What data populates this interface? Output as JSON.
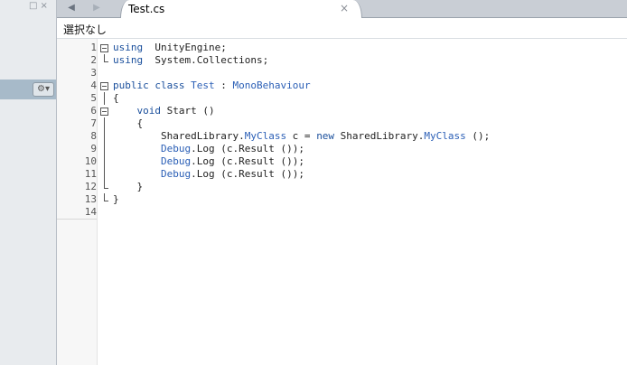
{
  "left_pad": {
    "controls": [
      "□",
      "×"
    ],
    "gear_label": "⚙▾"
  },
  "tabstrip": {
    "back_label": "◀",
    "forward_label": "▶",
    "tab_title": "Test.cs",
    "tab_close": "×"
  },
  "breadcrumb": {
    "text": "選択なし"
  },
  "editor": {
    "lines": [
      {
        "num": "1",
        "tokens": [
          [
            "kw",
            "using"
          ],
          [
            "",
            "  UnityEngine;"
          ]
        ]
      },
      {
        "num": "2",
        "tokens": [
          [
            "kw",
            "using"
          ],
          [
            "",
            "  System.Collections;"
          ]
        ]
      },
      {
        "num": "3",
        "tokens": []
      },
      {
        "num": "4",
        "tokens": [
          [
            "kw",
            "public"
          ],
          [
            "",
            " "
          ],
          [
            "kw",
            "class"
          ],
          [
            "",
            " "
          ],
          [
            "ty",
            "Test"
          ],
          [
            "",
            " : "
          ],
          [
            "ty",
            "MonoBehaviour"
          ]
        ]
      },
      {
        "num": "5",
        "tokens": [
          [
            "",
            "{"
          ]
        ]
      },
      {
        "num": "6",
        "tokens": [
          [
            "",
            "    "
          ],
          [
            "kw",
            "void"
          ],
          [
            "",
            " Start ()"
          ]
        ]
      },
      {
        "num": "7",
        "tokens": [
          [
            "",
            "    {"
          ]
        ]
      },
      {
        "num": "8",
        "tokens": [
          [
            "",
            "        SharedLibrary."
          ],
          [
            "ty",
            "MyClass"
          ],
          [
            "",
            " c = "
          ],
          [
            "kw",
            "new"
          ],
          [
            "",
            " SharedLibrary."
          ],
          [
            "ty",
            "MyClass"
          ],
          [
            "",
            " ();"
          ]
        ]
      },
      {
        "num": "9",
        "tokens": [
          [
            "",
            "        "
          ],
          [
            "ty",
            "Debug"
          ],
          [
            "",
            ".Log (c.Result ());"
          ]
        ]
      },
      {
        "num": "10",
        "tokens": [
          [
            "",
            "        "
          ],
          [
            "ty",
            "Debug"
          ],
          [
            "",
            ".Log (c.Result ());"
          ]
        ]
      },
      {
        "num": "11",
        "tokens": [
          [
            "",
            "        "
          ],
          [
            "ty",
            "Debug"
          ],
          [
            "",
            ".Log (c.Result ());"
          ]
        ]
      },
      {
        "num": "12",
        "tokens": [
          [
            "",
            "    }"
          ]
        ]
      },
      {
        "num": "13",
        "tokens": [
          [
            "",
            "}"
          ]
        ]
      },
      {
        "num": "14",
        "tokens": []
      }
    ]
  },
  "colors": {
    "keyword": "#1a4f9c",
    "type": "#2b5fb6",
    "pad_bar": "#a7bac9"
  }
}
